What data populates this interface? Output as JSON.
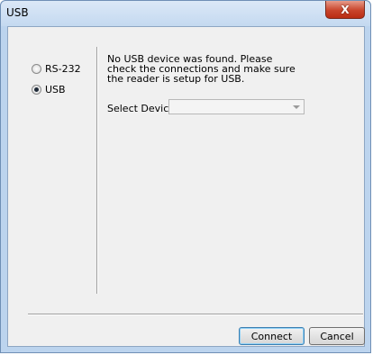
{
  "window": {
    "title": "USB",
    "close_label": "X"
  },
  "connection_types": [
    {
      "label": "RS-232",
      "checked": false
    },
    {
      "label": "USB",
      "checked": true
    }
  ],
  "message": "No USB device was found. Please check the connections and make sure the reader is setup for USB.",
  "device_select": {
    "label": "Select Device:",
    "value": ""
  },
  "buttons": {
    "connect": "Connect",
    "cancel": "Cancel"
  }
}
